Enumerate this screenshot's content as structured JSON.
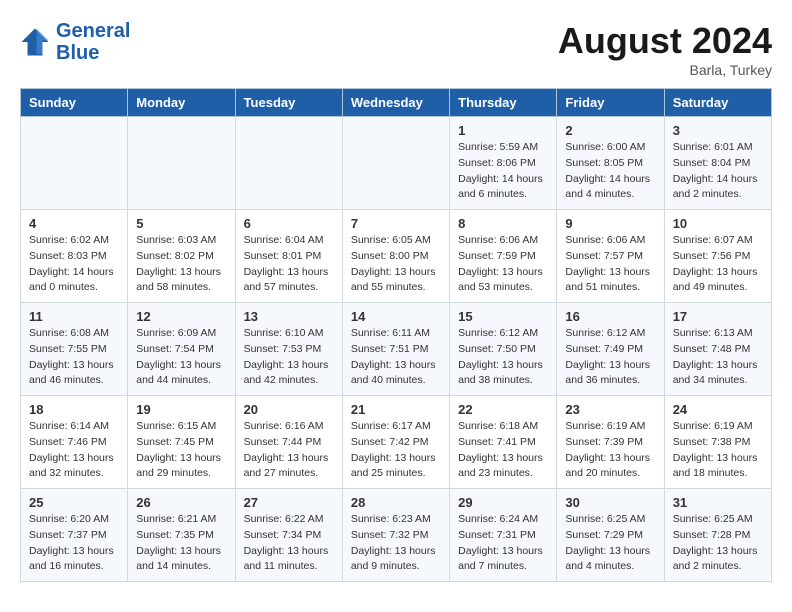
{
  "header": {
    "logo_line1": "General",
    "logo_line2": "Blue",
    "month": "August 2024",
    "location": "Barla, Turkey"
  },
  "days_of_week": [
    "Sunday",
    "Monday",
    "Tuesday",
    "Wednesday",
    "Thursday",
    "Friday",
    "Saturday"
  ],
  "weeks": [
    [
      {
        "day": "",
        "info": ""
      },
      {
        "day": "",
        "info": ""
      },
      {
        "day": "",
        "info": ""
      },
      {
        "day": "",
        "info": ""
      },
      {
        "day": "1",
        "info": "Sunrise: 5:59 AM\nSunset: 8:06 PM\nDaylight: 14 hours\nand 6 minutes."
      },
      {
        "day": "2",
        "info": "Sunrise: 6:00 AM\nSunset: 8:05 PM\nDaylight: 14 hours\nand 4 minutes."
      },
      {
        "day": "3",
        "info": "Sunrise: 6:01 AM\nSunset: 8:04 PM\nDaylight: 14 hours\nand 2 minutes."
      }
    ],
    [
      {
        "day": "4",
        "info": "Sunrise: 6:02 AM\nSunset: 8:03 PM\nDaylight: 14 hours\nand 0 minutes."
      },
      {
        "day": "5",
        "info": "Sunrise: 6:03 AM\nSunset: 8:02 PM\nDaylight: 13 hours\nand 58 minutes."
      },
      {
        "day": "6",
        "info": "Sunrise: 6:04 AM\nSunset: 8:01 PM\nDaylight: 13 hours\nand 57 minutes."
      },
      {
        "day": "7",
        "info": "Sunrise: 6:05 AM\nSunset: 8:00 PM\nDaylight: 13 hours\nand 55 minutes."
      },
      {
        "day": "8",
        "info": "Sunrise: 6:06 AM\nSunset: 7:59 PM\nDaylight: 13 hours\nand 53 minutes."
      },
      {
        "day": "9",
        "info": "Sunrise: 6:06 AM\nSunset: 7:57 PM\nDaylight: 13 hours\nand 51 minutes."
      },
      {
        "day": "10",
        "info": "Sunrise: 6:07 AM\nSunset: 7:56 PM\nDaylight: 13 hours\nand 49 minutes."
      }
    ],
    [
      {
        "day": "11",
        "info": "Sunrise: 6:08 AM\nSunset: 7:55 PM\nDaylight: 13 hours\nand 46 minutes."
      },
      {
        "day": "12",
        "info": "Sunrise: 6:09 AM\nSunset: 7:54 PM\nDaylight: 13 hours\nand 44 minutes."
      },
      {
        "day": "13",
        "info": "Sunrise: 6:10 AM\nSunset: 7:53 PM\nDaylight: 13 hours\nand 42 minutes."
      },
      {
        "day": "14",
        "info": "Sunrise: 6:11 AM\nSunset: 7:51 PM\nDaylight: 13 hours\nand 40 minutes."
      },
      {
        "day": "15",
        "info": "Sunrise: 6:12 AM\nSunset: 7:50 PM\nDaylight: 13 hours\nand 38 minutes."
      },
      {
        "day": "16",
        "info": "Sunrise: 6:12 AM\nSunset: 7:49 PM\nDaylight: 13 hours\nand 36 minutes."
      },
      {
        "day": "17",
        "info": "Sunrise: 6:13 AM\nSunset: 7:48 PM\nDaylight: 13 hours\nand 34 minutes."
      }
    ],
    [
      {
        "day": "18",
        "info": "Sunrise: 6:14 AM\nSunset: 7:46 PM\nDaylight: 13 hours\nand 32 minutes."
      },
      {
        "day": "19",
        "info": "Sunrise: 6:15 AM\nSunset: 7:45 PM\nDaylight: 13 hours\nand 29 minutes."
      },
      {
        "day": "20",
        "info": "Sunrise: 6:16 AM\nSunset: 7:44 PM\nDaylight: 13 hours\nand 27 minutes."
      },
      {
        "day": "21",
        "info": "Sunrise: 6:17 AM\nSunset: 7:42 PM\nDaylight: 13 hours\nand 25 minutes."
      },
      {
        "day": "22",
        "info": "Sunrise: 6:18 AM\nSunset: 7:41 PM\nDaylight: 13 hours\nand 23 minutes."
      },
      {
        "day": "23",
        "info": "Sunrise: 6:19 AM\nSunset: 7:39 PM\nDaylight: 13 hours\nand 20 minutes."
      },
      {
        "day": "24",
        "info": "Sunrise: 6:19 AM\nSunset: 7:38 PM\nDaylight: 13 hours\nand 18 minutes."
      }
    ],
    [
      {
        "day": "25",
        "info": "Sunrise: 6:20 AM\nSunset: 7:37 PM\nDaylight: 13 hours\nand 16 minutes."
      },
      {
        "day": "26",
        "info": "Sunrise: 6:21 AM\nSunset: 7:35 PM\nDaylight: 13 hours\nand 14 minutes."
      },
      {
        "day": "27",
        "info": "Sunrise: 6:22 AM\nSunset: 7:34 PM\nDaylight: 13 hours\nand 11 minutes."
      },
      {
        "day": "28",
        "info": "Sunrise: 6:23 AM\nSunset: 7:32 PM\nDaylight: 13 hours\nand 9 minutes."
      },
      {
        "day": "29",
        "info": "Sunrise: 6:24 AM\nSunset: 7:31 PM\nDaylight: 13 hours\nand 7 minutes."
      },
      {
        "day": "30",
        "info": "Sunrise: 6:25 AM\nSunset: 7:29 PM\nDaylight: 13 hours\nand 4 minutes."
      },
      {
        "day": "31",
        "info": "Sunrise: 6:25 AM\nSunset: 7:28 PM\nDaylight: 13 hours\nand 2 minutes."
      }
    ]
  ]
}
